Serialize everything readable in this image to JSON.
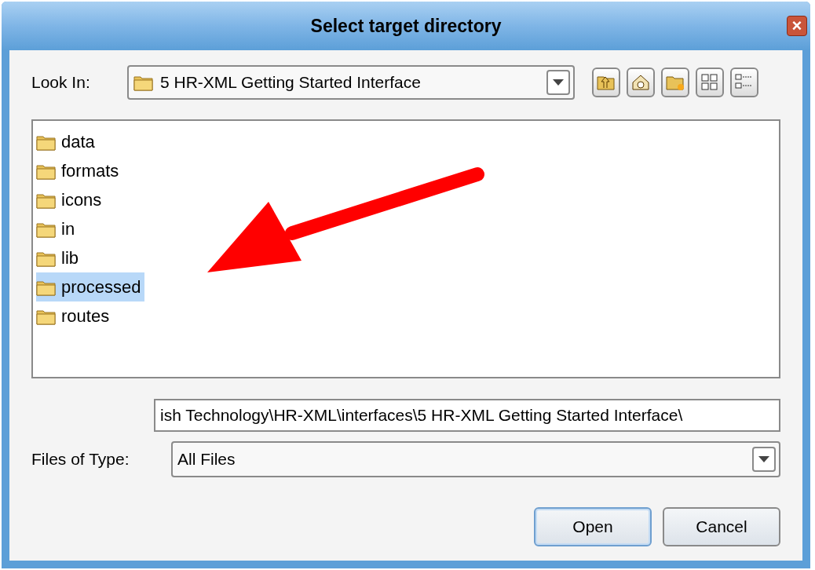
{
  "window": {
    "title": "Select target directory",
    "close": "×"
  },
  "look_in": {
    "label": "Look In:",
    "value": "5 HR-XML Getting Started Interface"
  },
  "toolbar": [
    {
      "kind": "up"
    },
    {
      "kind": "home"
    },
    {
      "kind": "new_folder"
    },
    {
      "kind": "list"
    },
    {
      "kind": "details"
    }
  ],
  "files": [
    {
      "name": "data",
      "selected": false
    },
    {
      "name": "formats",
      "selected": false
    },
    {
      "name": "icons",
      "selected": false
    },
    {
      "name": "in",
      "selected": false
    },
    {
      "name": "lib",
      "selected": false
    },
    {
      "name": "processed",
      "selected": true
    },
    {
      "name": "routes",
      "selected": false
    }
  ],
  "file_name": {
    "value": "ish Technology\\HR-XML\\interfaces\\5 HR-XML Getting Started Interface\\"
  },
  "file_type": {
    "label": "Files of Type:",
    "value": "All Files"
  },
  "buttons": [
    {
      "label": "Open",
      "default": true
    },
    {
      "label": "Cancel",
      "default": false
    }
  ],
  "annotation": {
    "kind": "arrow"
  }
}
